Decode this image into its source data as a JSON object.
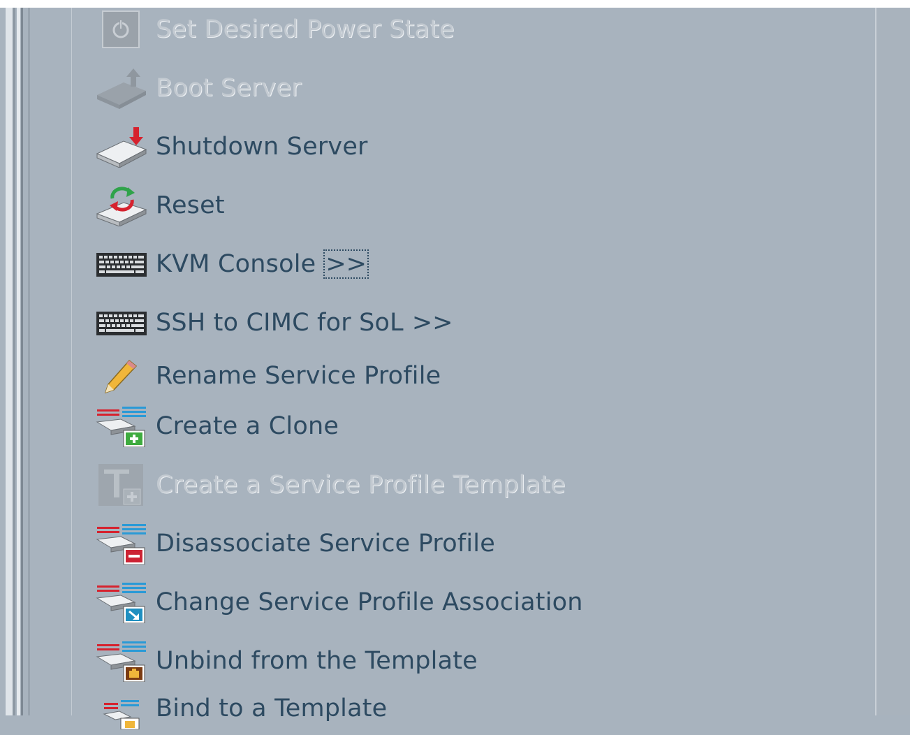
{
  "menu": {
    "items": [
      {
        "id": "set-desired-power-state",
        "label": "Set Desired Power State",
        "icon": "power-icon",
        "enabled": false,
        "more": ""
      },
      {
        "id": "boot-server",
        "label": "Boot Server",
        "icon": "boot-server-icon",
        "enabled": false,
        "more": ""
      },
      {
        "id": "shutdown-server",
        "label": "Shutdown Server",
        "icon": "shutdown-server-icon",
        "enabled": true,
        "more": ""
      },
      {
        "id": "reset",
        "label": "Reset",
        "icon": "reset-icon",
        "enabled": true,
        "more": ""
      },
      {
        "id": "kvm-console",
        "label": "KVM Console",
        "icon": "keyboard-icon",
        "enabled": true,
        "more": ">>"
      },
      {
        "id": "ssh-cimc-sol",
        "label": "SSH to CIMC for SoL",
        "icon": "keyboard-icon",
        "enabled": true,
        "more": ">>"
      },
      {
        "id": "rename-service-profile",
        "label": "Rename Service Profile",
        "icon": "pencil-icon",
        "enabled": true,
        "more": ""
      },
      {
        "id": "create-clone",
        "label": "Create a Clone",
        "icon": "clone-add-icon",
        "enabled": true,
        "more": ""
      },
      {
        "id": "create-sp-template",
        "label": "Create a Service Profile Template",
        "icon": "template-icon",
        "enabled": false,
        "more": ""
      },
      {
        "id": "disassociate-sp",
        "label": "Disassociate Service Profile",
        "icon": "disassociate-icon",
        "enabled": true,
        "more": ""
      },
      {
        "id": "change-sp-association",
        "label": "Change Service Profile Association",
        "icon": "change-association-icon",
        "enabled": true,
        "more": ""
      },
      {
        "id": "unbind-template",
        "label": "Unbind from the Template",
        "icon": "unbind-template-icon",
        "enabled": true,
        "more": ""
      },
      {
        "id": "bind-template",
        "label": "Bind to a Template",
        "icon": "bind-template-icon",
        "enabled": true,
        "more": ""
      }
    ]
  },
  "colors": {
    "background": "#a8b3be",
    "label": "#2d4a61",
    "disabled_label": "#c3cad1"
  }
}
